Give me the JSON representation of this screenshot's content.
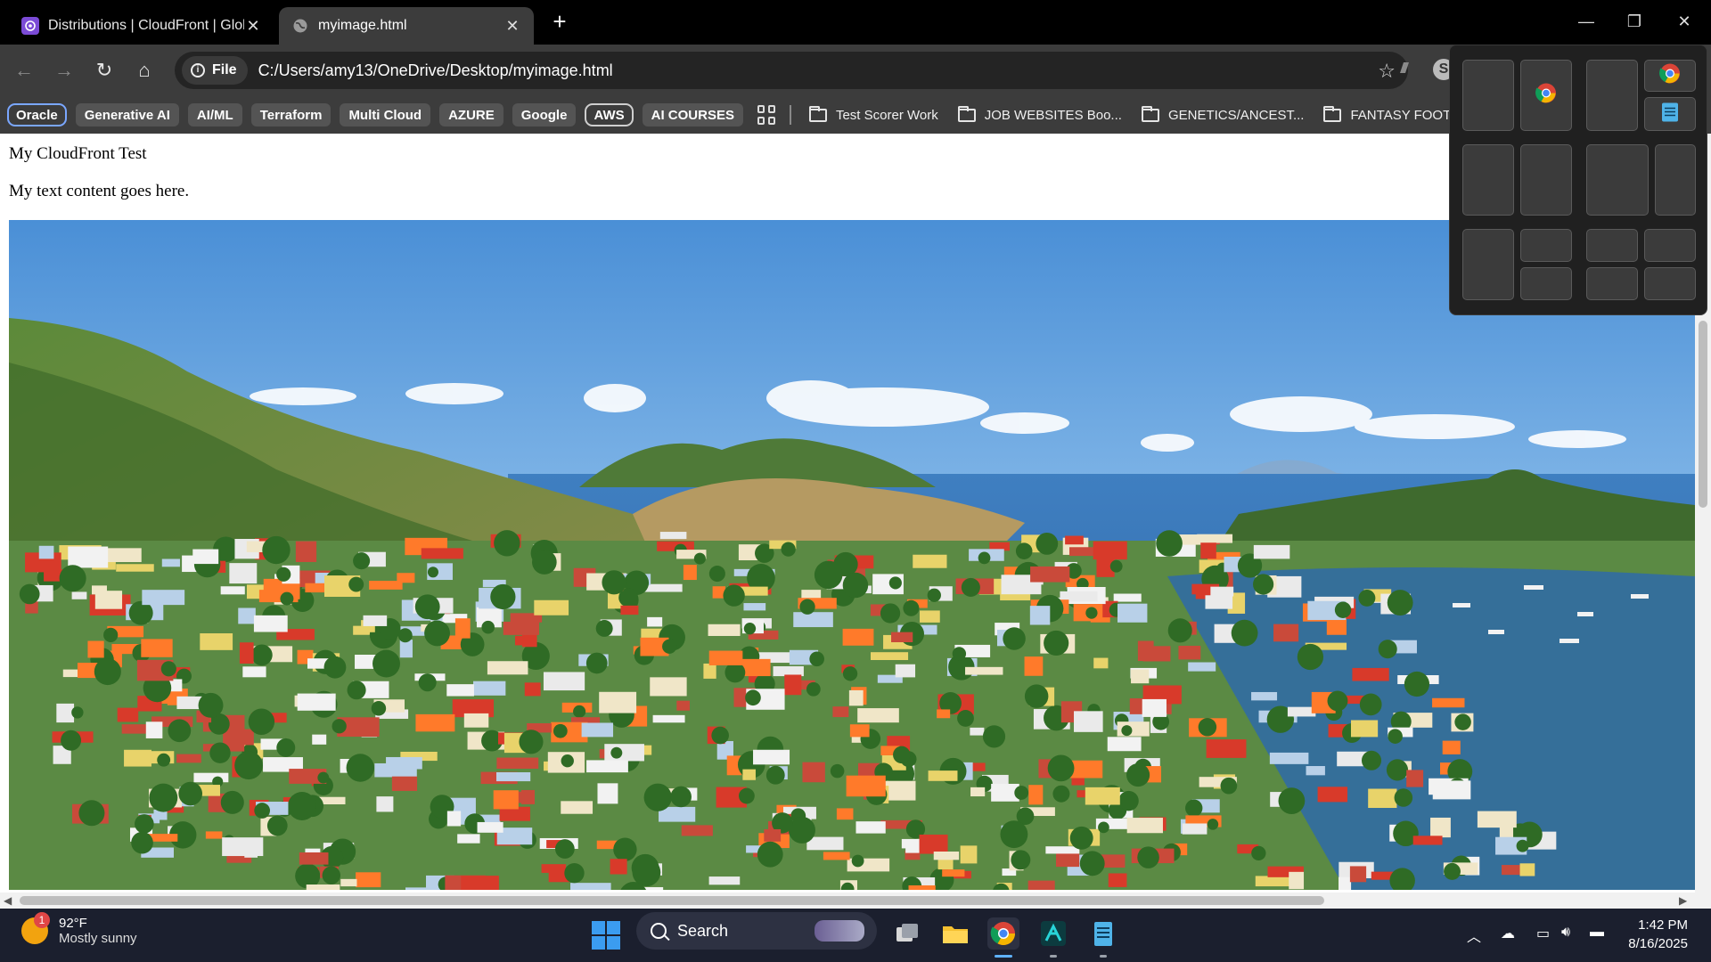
{
  "browser": {
    "tabs": [
      {
        "title": "Distributions | CloudFront | Glol",
        "active": false,
        "close": "✕"
      },
      {
        "title": "myimage.html",
        "active": true,
        "close": "✕"
      }
    ],
    "new_tab": "+",
    "window_controls": {
      "minimize": "—",
      "restore": "❐",
      "close": "✕"
    }
  },
  "toolbar": {
    "back": "←",
    "forward": "→",
    "reload": "↻",
    "home": "⌂",
    "scheme_chip": "File",
    "url": "C:/Users/amy13/OneDrive/Desktop/myimage.html",
    "bookmark_star": "☆"
  },
  "bookmarks": {
    "chips": [
      "Oracle",
      "Generative AI",
      "AI/ML",
      "Terraform",
      "Multi Cloud",
      "AZURE",
      "Google",
      "AWS",
      "AI COURSES"
    ],
    "folders": [
      "Test Scorer Work",
      "JOB WEBSITES Boo...",
      "GENETICS/ANCEST...",
      "FANTASY FOOTBAL..."
    ]
  },
  "page": {
    "heading": "My CloudFront Test",
    "text": "My text content goes here."
  },
  "taskbar": {
    "weather": {
      "temp": "92°F",
      "condition": "Mostly sunny",
      "badge": "1"
    },
    "search_label": "Search",
    "clock": {
      "time": "1:42 PM",
      "date": "8/16/2025"
    }
  },
  "colors": {
    "accent": "#3b9cf0",
    "tab_bg": "#3c3c3c",
    "taskbar_bg": "#1b1f2e"
  }
}
